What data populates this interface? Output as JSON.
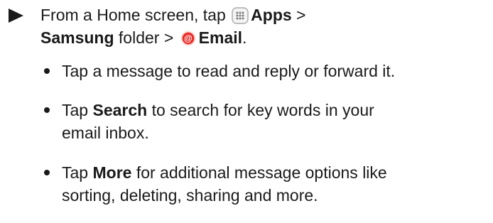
{
  "step": {
    "part1": "From a Home screen, tap",
    "apps": "Apps",
    "part2": " >",
    "samsung": "Samsung",
    "part3": " folder > ",
    "email": "Email",
    "part4": ".",
    "apps_icon": "apps-grid-icon",
    "email_icon": "email-at-icon"
  },
  "bullets": [
    {
      "pre": "Tap a message to read and reply or forward it.",
      "bold": "",
      "post": ""
    },
    {
      "pre": "Tap ",
      "bold": "Search",
      "post": " to search for key words in your email inbox."
    },
    {
      "pre": "Tap ",
      "bold": "More",
      "post": " for additional message options like sorting, deleting, sharing and more."
    }
  ],
  "colors": {
    "text": "#1a1a1a",
    "email_icon_red": "#e8302d",
    "apps_icon_gray": "#8c8c8c"
  }
}
